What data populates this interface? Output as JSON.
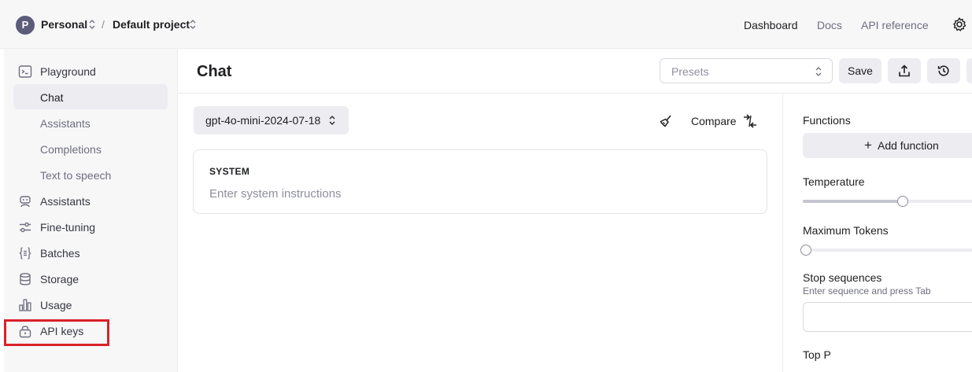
{
  "topbar": {
    "avatar_letter": "P",
    "org": "Personal",
    "separator": "/",
    "project": "Default project",
    "nav": [
      "Dashboard",
      "Docs",
      "API reference"
    ]
  },
  "sidebar": {
    "items": [
      {
        "label": "Playground",
        "icon": "terminal-icon"
      },
      {
        "label": "Chat"
      },
      {
        "label": "Assistants"
      },
      {
        "label": "Completions"
      },
      {
        "label": "Text to speech"
      },
      {
        "label": "Assistants",
        "icon": "robot-icon"
      },
      {
        "label": "Fine-tuning",
        "icon": "sliders-icon"
      },
      {
        "label": "Batches",
        "icon": "braces-icon"
      },
      {
        "label": "Storage",
        "icon": "database-icon"
      },
      {
        "label": "Usage",
        "icon": "bar-chart-icon"
      },
      {
        "label": "API keys",
        "icon": "lock-icon"
      }
    ],
    "selected": "Chat",
    "highlight_color": "#d92228"
  },
  "header": {
    "title": "Chat",
    "presets_placeholder": "Presets",
    "save_label": "Save"
  },
  "chat": {
    "model": "gpt-4o-mini-2024-07-18",
    "compare_label": "Compare",
    "system_title": "SYSTEM",
    "system_placeholder": "Enter system instructions"
  },
  "settings": {
    "functions_label": "Functions",
    "add_function_label": "Add function",
    "temperature_label": "Temperature",
    "temperature_fraction": 0.55,
    "max_tokens_label": "Maximum Tokens",
    "max_tokens_fraction": 0.0,
    "stop_label": "Stop sequences",
    "stop_hint": "Enter sequence and press Tab",
    "top_p_label": "Top P"
  }
}
